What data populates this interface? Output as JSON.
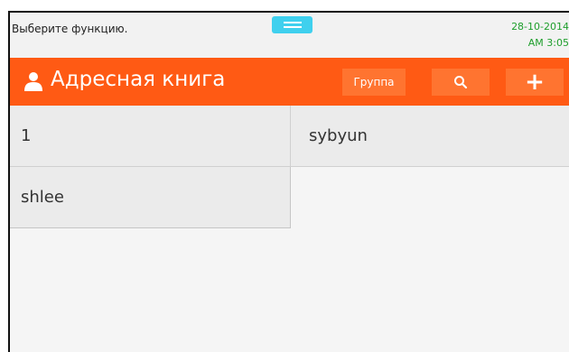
{
  "status": {
    "prompt": "Выберите функцию.",
    "date": "28-10-2014",
    "time": "AM 3:05"
  },
  "header": {
    "title": "Адресная книга",
    "group_label": "Группа",
    "add_label": "+"
  },
  "contacts": [
    "1",
    "sybyun",
    "shlee"
  ],
  "colors": {
    "accent": "#ff5a14",
    "button": "#ff7430",
    "clock": "#1e9e2c",
    "handle": "#3fd0ee"
  },
  "icons": {
    "person": "person-icon",
    "search": "search-icon",
    "handle": "drag-handle-icon"
  }
}
